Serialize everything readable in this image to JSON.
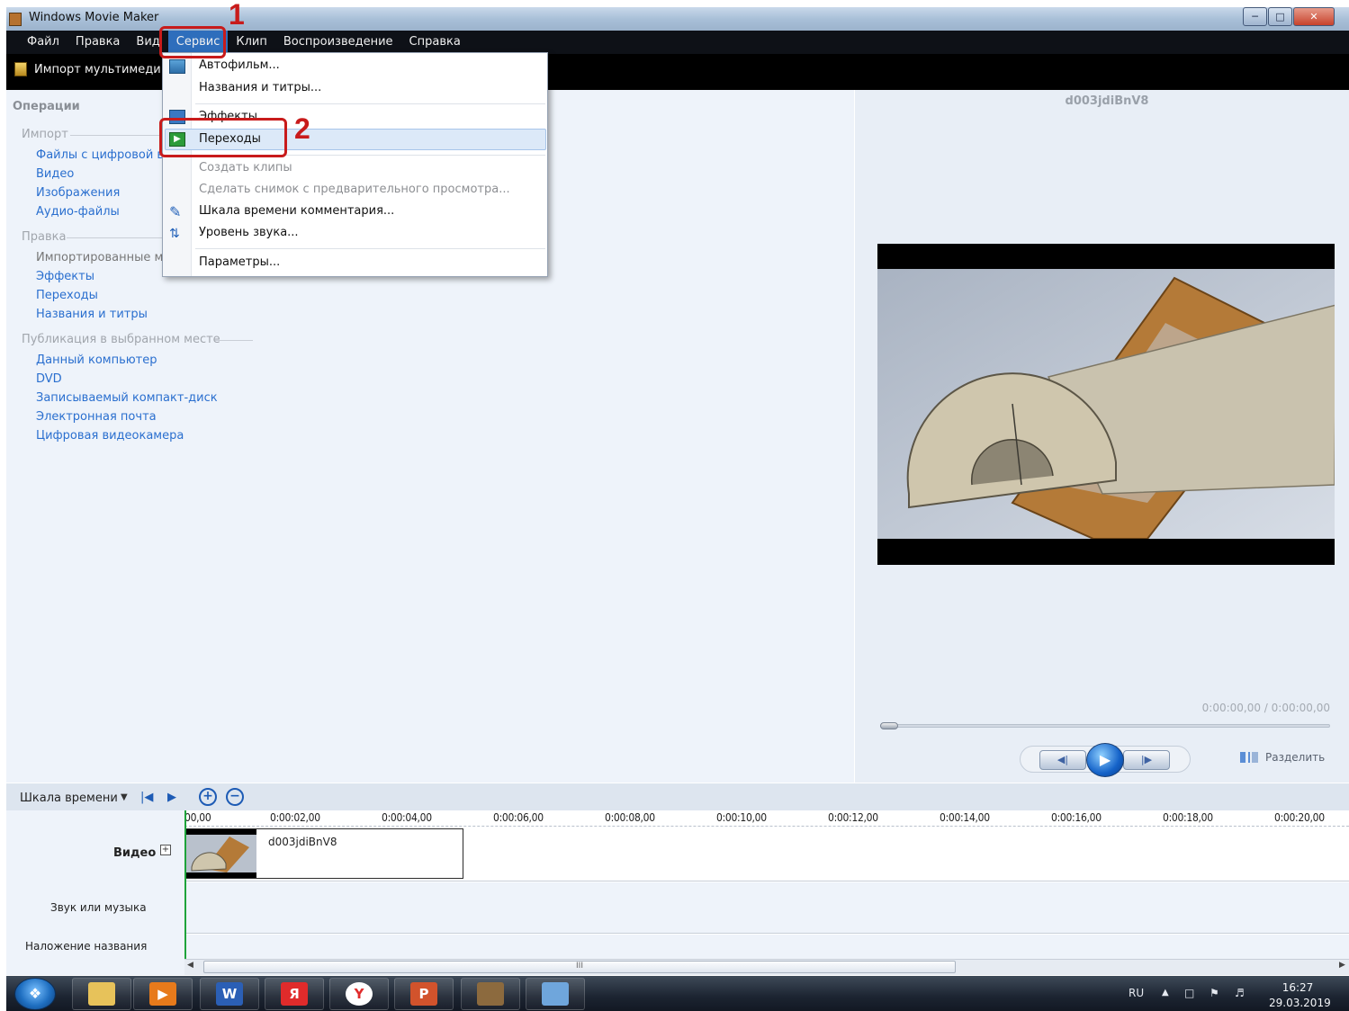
{
  "window": {
    "title": "Windows Movie Maker"
  },
  "menubar": [
    "Файл",
    "Правка",
    "Вид",
    "Сервис",
    "Клип",
    "Воспроизведение",
    "Справка"
  ],
  "toolbar": {
    "import_label": "Импорт мультимеди"
  },
  "left_pane": {
    "title": "Операции",
    "import": {
      "title": "Импорт",
      "links": [
        "Файлы с цифровой в",
        "Видео",
        "Изображения",
        "Аудио-файлы"
      ]
    },
    "edit": {
      "title": "Правка",
      "links": [
        "Импортированные м",
        "Эффекты",
        "Переходы",
        "Названия и титры"
      ]
    },
    "publish": {
      "title": "Публикация в выбранном месте",
      "links": [
        "Данный компьютер",
        "DVD",
        "Записываемый компакт-диск",
        "Электронная почта",
        "Цифровая видеокамера"
      ]
    }
  },
  "dropdown": {
    "items": [
      "Автофильм...",
      "Названия и титры...",
      "Эффекты",
      "Переходы",
      "Создать клипы",
      "Сделать снимок с предварительного просмотра...",
      "Шкала времени комментария...",
      "Уровень звука...",
      "Параметры..."
    ]
  },
  "annotations": {
    "step1": "1",
    "step2": "2",
    "color": "#c81b1b"
  },
  "preview": {
    "clip_name": "d003jdiBnV8",
    "time": "0:00:00,00 / 0:00:00,00",
    "split_label": "Разделить"
  },
  "timeline": {
    "label": "Шкала времени",
    "ticks": [
      "00,00",
      "0:00:02,00",
      "0:00:04,00",
      "0:00:06,00",
      "0:00:08,00",
      "0:00:10,00",
      "0:00:12,00",
      "0:00:14,00",
      "0:00:16,00",
      "0:00:18,00",
      "0:00:20,00"
    ],
    "tracks": {
      "video": "Видео",
      "audio": "Звук или музыка",
      "overlay": "Наложение названия"
    },
    "clip_title": "d003jdiBnV8",
    "scroll_grip": "III"
  },
  "taskbar": {
    "language": "RU",
    "time": "16:27",
    "date": "29.03.2019"
  }
}
